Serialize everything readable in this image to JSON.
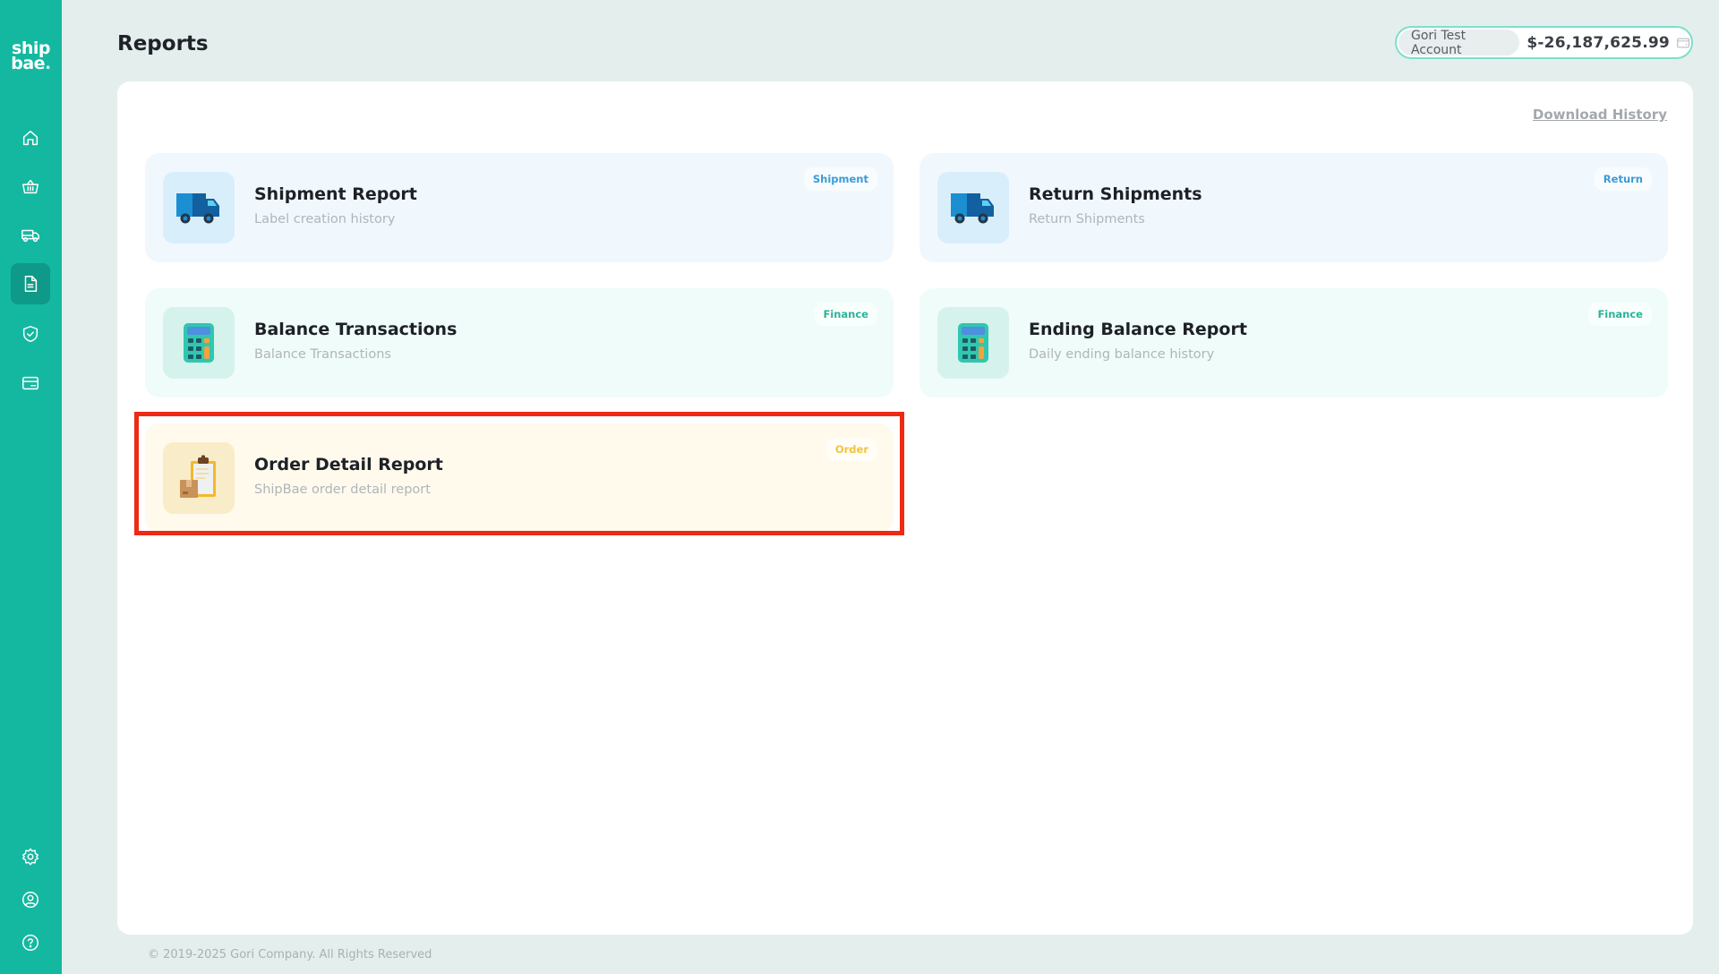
{
  "app": {
    "logo_line1": "ship",
    "logo_line2": "bae",
    "logo_dot": "."
  },
  "sidebar": {
    "items": [
      {
        "name": "home",
        "icon": "home-icon",
        "active": false
      },
      {
        "name": "orders",
        "icon": "basket-icon",
        "active": false
      },
      {
        "name": "shipments",
        "icon": "truck-icon",
        "active": false
      },
      {
        "name": "reports",
        "icon": "document-icon",
        "active": true
      },
      {
        "name": "insurance",
        "icon": "shield-check-icon",
        "active": false
      },
      {
        "name": "billing",
        "icon": "credit-card-icon",
        "active": false
      }
    ],
    "bottom_items": [
      {
        "name": "settings",
        "icon": "gear-icon"
      },
      {
        "name": "account",
        "icon": "user-circle-icon"
      },
      {
        "name": "help",
        "icon": "question-circle-icon"
      }
    ]
  },
  "header": {
    "title": "Reports",
    "account_name": "Gori Test Account",
    "account_balance": "$-26,187,625.99",
    "wallet_icon": "wallet-icon"
  },
  "main": {
    "download_history_label": "Download History",
    "cards": [
      {
        "title": "Shipment Report",
        "subtitle": "Label creation history",
        "tag": "Shipment",
        "icon": "truck-icon",
        "theme": "blue"
      },
      {
        "title": "Return Shipments",
        "subtitle": "Return Shipments",
        "tag": "Return",
        "icon": "truck-icon",
        "theme": "blue"
      },
      {
        "title": "Balance Transactions",
        "subtitle": "Balance Transactions",
        "tag": "Finance",
        "icon": "calculator-icon",
        "theme": "green"
      },
      {
        "title": "Ending Balance Report",
        "subtitle": "Daily ending balance history",
        "tag": "Finance",
        "icon": "calculator-icon",
        "theme": "green"
      },
      {
        "title": "Order Detail Report",
        "subtitle": "ShipBae order detail report",
        "tag": "Order",
        "icon": "clipboard-box-icon",
        "theme": "yellow",
        "highlighted": true
      }
    ]
  },
  "colors": {
    "brand": "#14b8a0",
    "highlight_border": "#ee2a14",
    "shipment_tag": "#3a9bd8",
    "finance_tag": "#2bb39a",
    "order_tag": "#efc43e"
  },
  "footer": {
    "copyright": "© 2019-2025 Gori Company. All Rights Reserved"
  }
}
